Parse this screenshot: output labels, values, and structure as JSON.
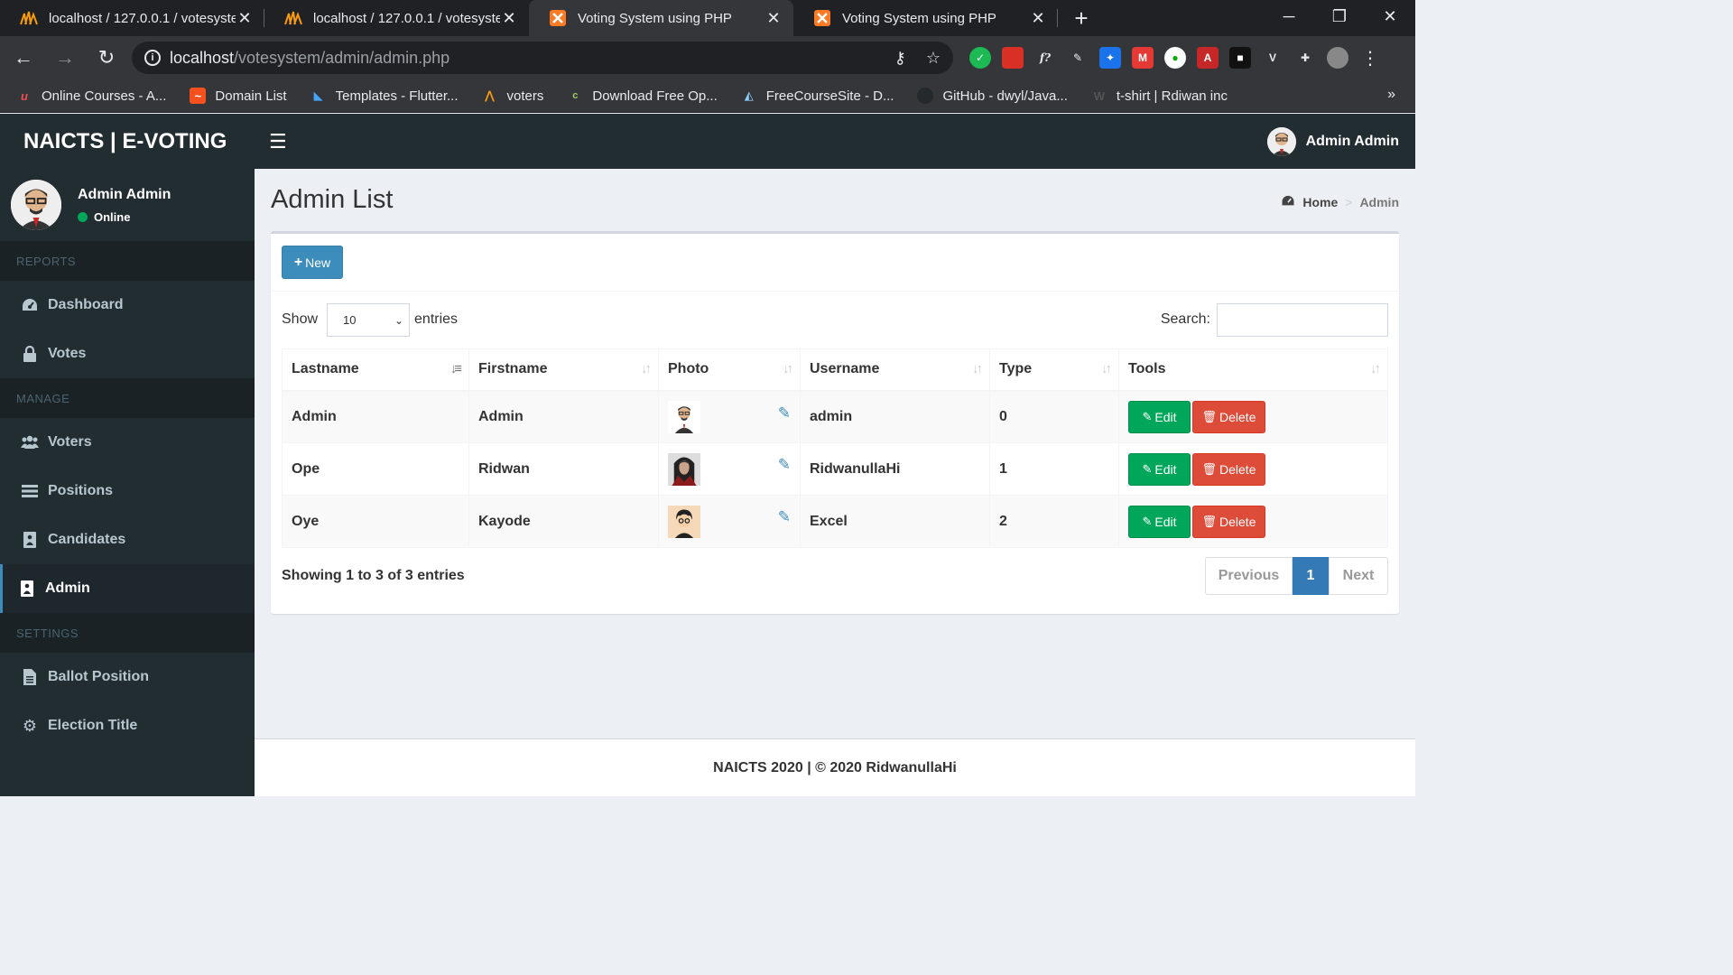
{
  "browser": {
    "tabs": [
      {
        "title": "localhost / 127.0.0.1 / votesystem",
        "icon": "phpmyadmin-icon",
        "active": false
      },
      {
        "title": "localhost / 127.0.0.1 / votesystem",
        "icon": "phpmyadmin-icon",
        "active": false
      },
      {
        "title": "Voting System using PHP",
        "icon": "xampp-icon",
        "active": true
      },
      {
        "title": "Voting System using PHP",
        "icon": "xampp-icon",
        "active": false
      }
    ],
    "url_host": "localhost",
    "url_path": "/votesystem/admin/admin.php",
    "bookmarks": [
      {
        "label": "Online Courses - A...",
        "icon": "udemy-icon"
      },
      {
        "label": "Domain List",
        "icon": "domain-icon"
      },
      {
        "label": "Templates - Flutter...",
        "icon": "flutter-icon"
      },
      {
        "label": "voters",
        "icon": "phpmyadmin-icon"
      },
      {
        "label": "Download Free Op...",
        "icon": "c-icon"
      },
      {
        "label": "FreeCourseSite - D...",
        "icon": "fcs-icon"
      },
      {
        "label": "GitHub - dwyl/Java...",
        "icon": "github-icon"
      },
      {
        "label": "t-shirt | Rdiwan inc",
        "icon": "wix-icon"
      }
    ]
  },
  "app": {
    "logo": "NAICTS | E-VOTING",
    "user_name": "Admin Admin",
    "user_status": "Online"
  },
  "sidebar": {
    "sections": [
      {
        "header": "REPORTS",
        "items": [
          {
            "label": "Dashboard",
            "icon": "dashboard-icon"
          },
          {
            "label": "Votes",
            "icon": "lock-icon"
          }
        ]
      },
      {
        "header": "MANAGE",
        "items": [
          {
            "label": "Voters",
            "icon": "users-icon"
          },
          {
            "label": "Positions",
            "icon": "list-icon"
          },
          {
            "label": "Candidates",
            "icon": "candidate-icon"
          },
          {
            "label": "Admin",
            "icon": "admin-icon",
            "active": true
          }
        ]
      },
      {
        "header": "SETTINGS",
        "items": [
          {
            "label": "Ballot Position",
            "icon": "file-icon"
          },
          {
            "label": "Election Title",
            "icon": "cog-icon"
          }
        ]
      }
    ]
  },
  "page": {
    "title": "Admin List",
    "breadcrumb_home": "Home",
    "breadcrumb_current": "Admin",
    "new_button": "New",
    "show_label": "Show",
    "entries_value": "10",
    "entries_label": "entries",
    "search_label": "Search:",
    "columns": [
      "Lastname",
      "Firstname",
      "Photo",
      "Username",
      "Type",
      "Tools"
    ],
    "rows": [
      {
        "lastname": "Admin",
        "firstname": "Admin",
        "username": "admin",
        "type": "0",
        "photo": "avatar-admin"
      },
      {
        "lastname": "Ope",
        "firstname": "Ridwan",
        "username": "RidwanullaHi",
        "type": "1",
        "photo": "avatar-ridwan"
      },
      {
        "lastname": "Oye",
        "firstname": "Kayode",
        "username": "Excel",
        "type": "2",
        "photo": "avatar-kayode"
      }
    ],
    "edit_label": "Edit",
    "delete_label": "Delete",
    "info_text": "Showing 1 to 3 of 3 entries",
    "pagination": {
      "prev": "Previous",
      "current": "1",
      "next": "Next"
    }
  },
  "footer": {
    "text": "NAICTS 2020 | © 2020 RidwanullaHi"
  },
  "colors": {
    "header_bg": "#222d32",
    "sidebar_bg": "#222d32",
    "primary": "#3c8dbc",
    "success": "#00a65a",
    "danger": "#dd4b39",
    "content_bg": "#ecf0f5"
  }
}
